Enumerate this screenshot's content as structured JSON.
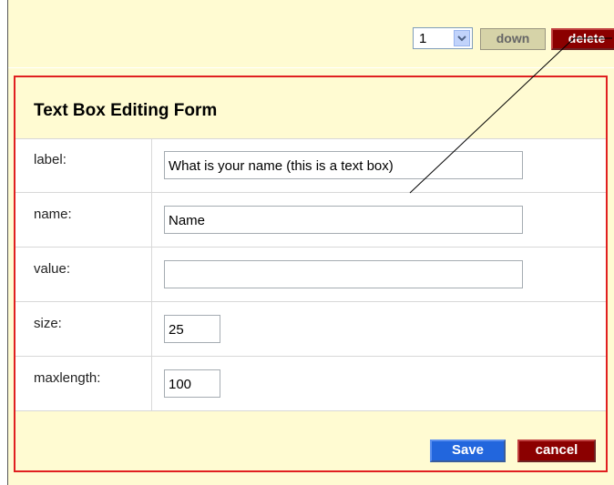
{
  "toolbar": {
    "order_value": "1",
    "down_label": "down",
    "delete_label": "delete"
  },
  "form": {
    "title": "Text Box Editing Form",
    "fields": [
      {
        "label": "label:",
        "value": "What is your name (this is a text box)"
      },
      {
        "label": "name:",
        "value": "Name"
      },
      {
        "label": "value:",
        "value": ""
      },
      {
        "label": "size:",
        "value": "25"
      },
      {
        "label": "maxlength:",
        "value": "100"
      }
    ],
    "save_label": "Save",
    "cancel_label": "cancel"
  },
  "colors": {
    "panel_bg": "#fffbd2",
    "form_border": "#e02020",
    "delete_red": "#8b0000",
    "save_blue": "#2266dd"
  }
}
